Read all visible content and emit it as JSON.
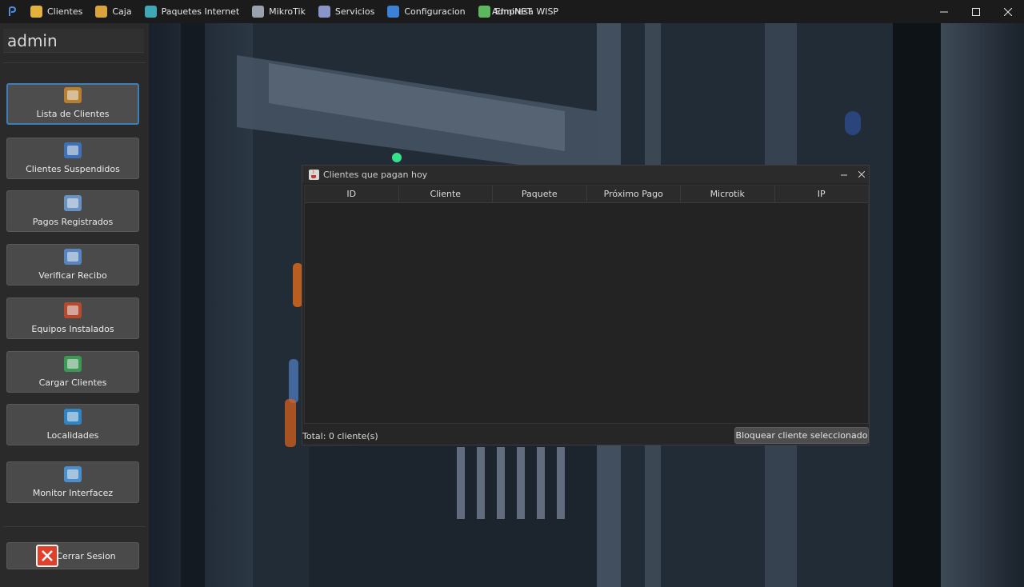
{
  "window": {
    "title": "AdmiNET"
  },
  "menu": [
    {
      "label": "Clientes",
      "icon": "users-icon",
      "color": "#e3b23c"
    },
    {
      "label": "Caja",
      "icon": "box-icon",
      "color": "#d9a43a"
    },
    {
      "label": "Paquetes Internet",
      "icon": "globe-icon",
      "color": "#3fa7b5"
    },
    {
      "label": "MikroTik",
      "icon": "router-icon",
      "color": "#9aa3ad"
    },
    {
      "label": "Servicios",
      "icon": "services-icon",
      "color": "#8a94c9"
    },
    {
      "label": "Configuracion",
      "icon": "settings-icon",
      "color": "#3b82d6"
    },
    {
      "label": "Empresa WISP",
      "icon": "company-icon",
      "color": "#5cb85c"
    }
  ],
  "sidebar": {
    "user": "admin",
    "buttons": [
      {
        "label": "Lista de Clientes",
        "icon": "users-icon",
        "active": true
      },
      {
        "label": "Clientes Suspendidos",
        "icon": "suspended-users-icon"
      },
      {
        "label": "Pagos Registrados",
        "icon": "payments-clock-icon"
      },
      {
        "label": "Verificar Recibo",
        "icon": "receipt-icon"
      },
      {
        "label": "Equipos Instalados",
        "icon": "equipment-icon"
      },
      {
        "label": "Cargar Clientes",
        "icon": "checkmark-icon"
      },
      {
        "label": "Localidades",
        "icon": "globe-icon"
      },
      {
        "label": "Monitor Interfacez",
        "icon": "monitor-icon"
      }
    ],
    "logout": {
      "label": "Cerrar Sesion",
      "icon": "close-x-icon",
      "color": "#e0402a"
    }
  },
  "dialog": {
    "title": "Clientes que pagan hoy",
    "columns": [
      "ID",
      "Cliente",
      "Paquete",
      "Próximo Pago",
      "Microtik",
      "IP"
    ],
    "rows": [],
    "total": "Total: 0 cliente(s)",
    "block_button": "Bloquear cliente seleccionado"
  },
  "colors": {
    "accent": "#3d7fb8",
    "sidebar_bg": "#2a2a2a",
    "button_bg": "#4a4a4a"
  }
}
